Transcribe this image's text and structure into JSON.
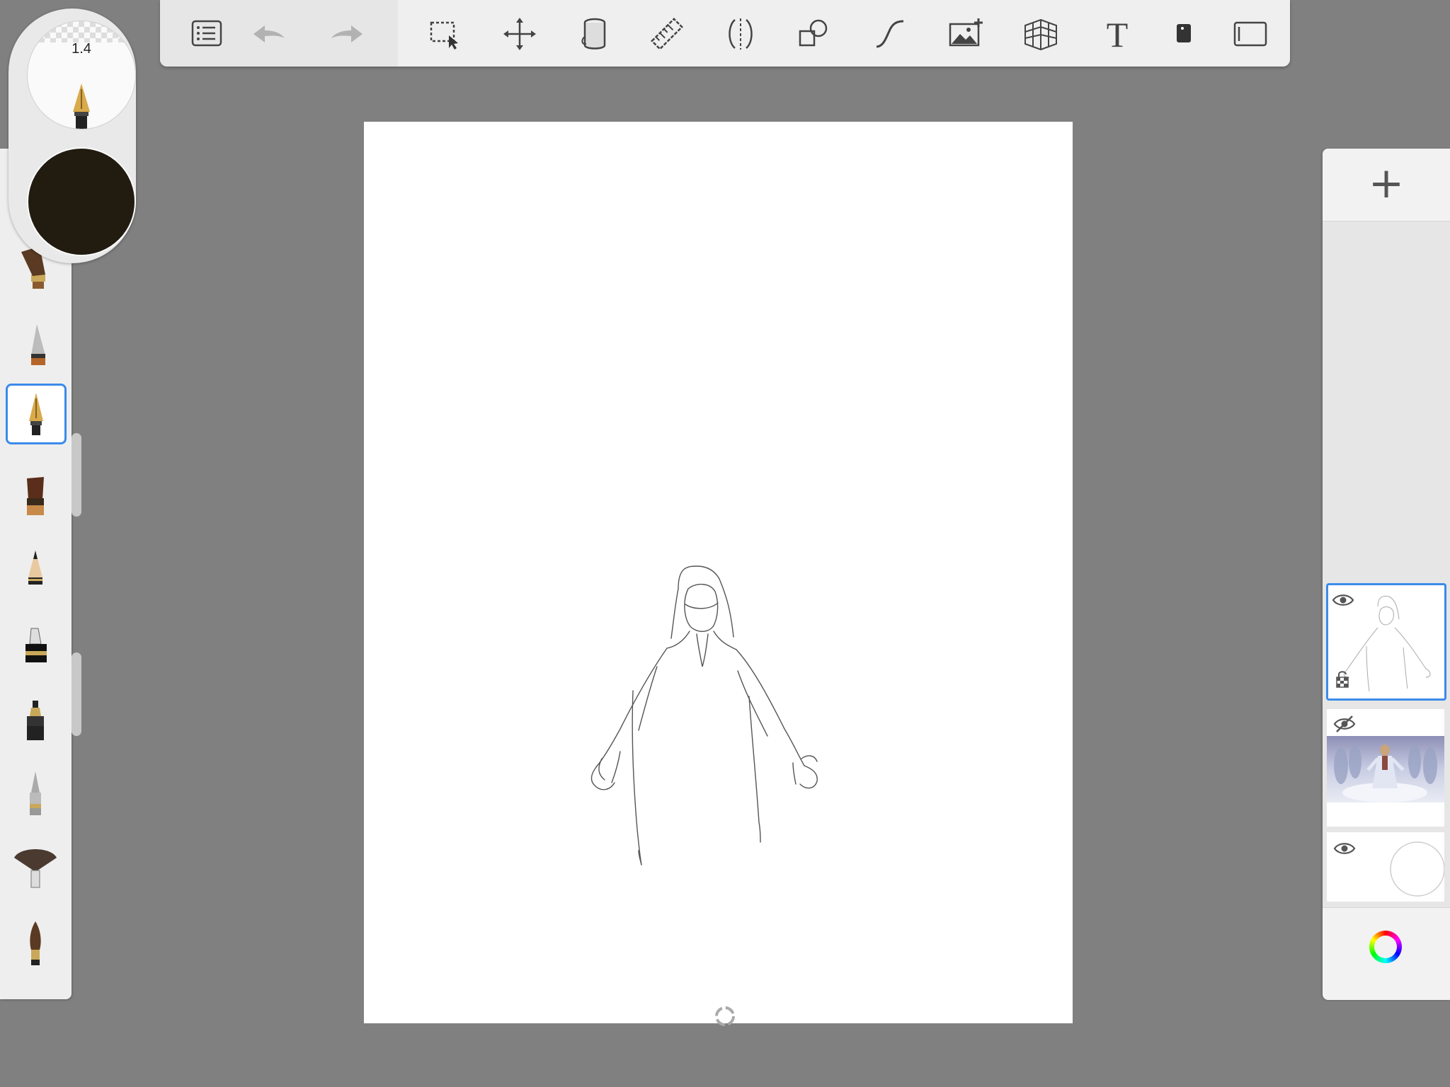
{
  "toolbar": {
    "tools": [
      {
        "id": "menu",
        "icon": "list-icon"
      },
      {
        "id": "undo",
        "icon": "undo-icon"
      },
      {
        "id": "redo",
        "icon": "redo-icon"
      },
      {
        "id": "selection",
        "icon": "selection-icon"
      },
      {
        "id": "transform",
        "icon": "move-arrows-icon"
      },
      {
        "id": "fill",
        "icon": "paint-bucket-icon"
      },
      {
        "id": "ruler",
        "icon": "ruler-icon"
      },
      {
        "id": "symmetry",
        "icon": "symmetry-icon"
      },
      {
        "id": "shapes",
        "icon": "shapes-icon"
      },
      {
        "id": "curve",
        "icon": "curve-icon"
      },
      {
        "id": "add-image",
        "icon": "add-image-icon"
      },
      {
        "id": "perspective",
        "icon": "perspective-grid-icon"
      },
      {
        "id": "text",
        "icon": "text-icon",
        "glyph": "T"
      },
      {
        "id": "copic",
        "icon": "marker-icon"
      },
      {
        "id": "fullscreen",
        "icon": "fullscreen-icon"
      }
    ]
  },
  "brush_puck": {
    "size_value": "1.4",
    "color": "#211c0f"
  },
  "brushes": {
    "items": [
      {
        "name": "flat-brush",
        "selected": false
      },
      {
        "name": "airbrush",
        "selected": false
      },
      {
        "name": "ink-pen",
        "selected": true
      },
      {
        "name": "paint-brush",
        "selected": false
      },
      {
        "name": "pencil",
        "selected": false
      },
      {
        "name": "marker",
        "selected": false
      },
      {
        "name": "fineliner",
        "selected": false
      },
      {
        "name": "ballpoint",
        "selected": false
      },
      {
        "name": "fan-brush",
        "selected": false
      },
      {
        "name": "round-brush",
        "selected": false
      }
    ]
  },
  "layers": {
    "add_label": "+",
    "items": [
      {
        "name": "sketch-layer",
        "visible": true,
        "selected": true
      },
      {
        "name": "reference-image-layer",
        "visible": false,
        "selected": false
      },
      {
        "name": "background-layer",
        "visible": true,
        "selected": false
      }
    ]
  },
  "colors": {
    "accent": "#3b8bea",
    "background": "#808080",
    "panel": "#eeeeee"
  }
}
